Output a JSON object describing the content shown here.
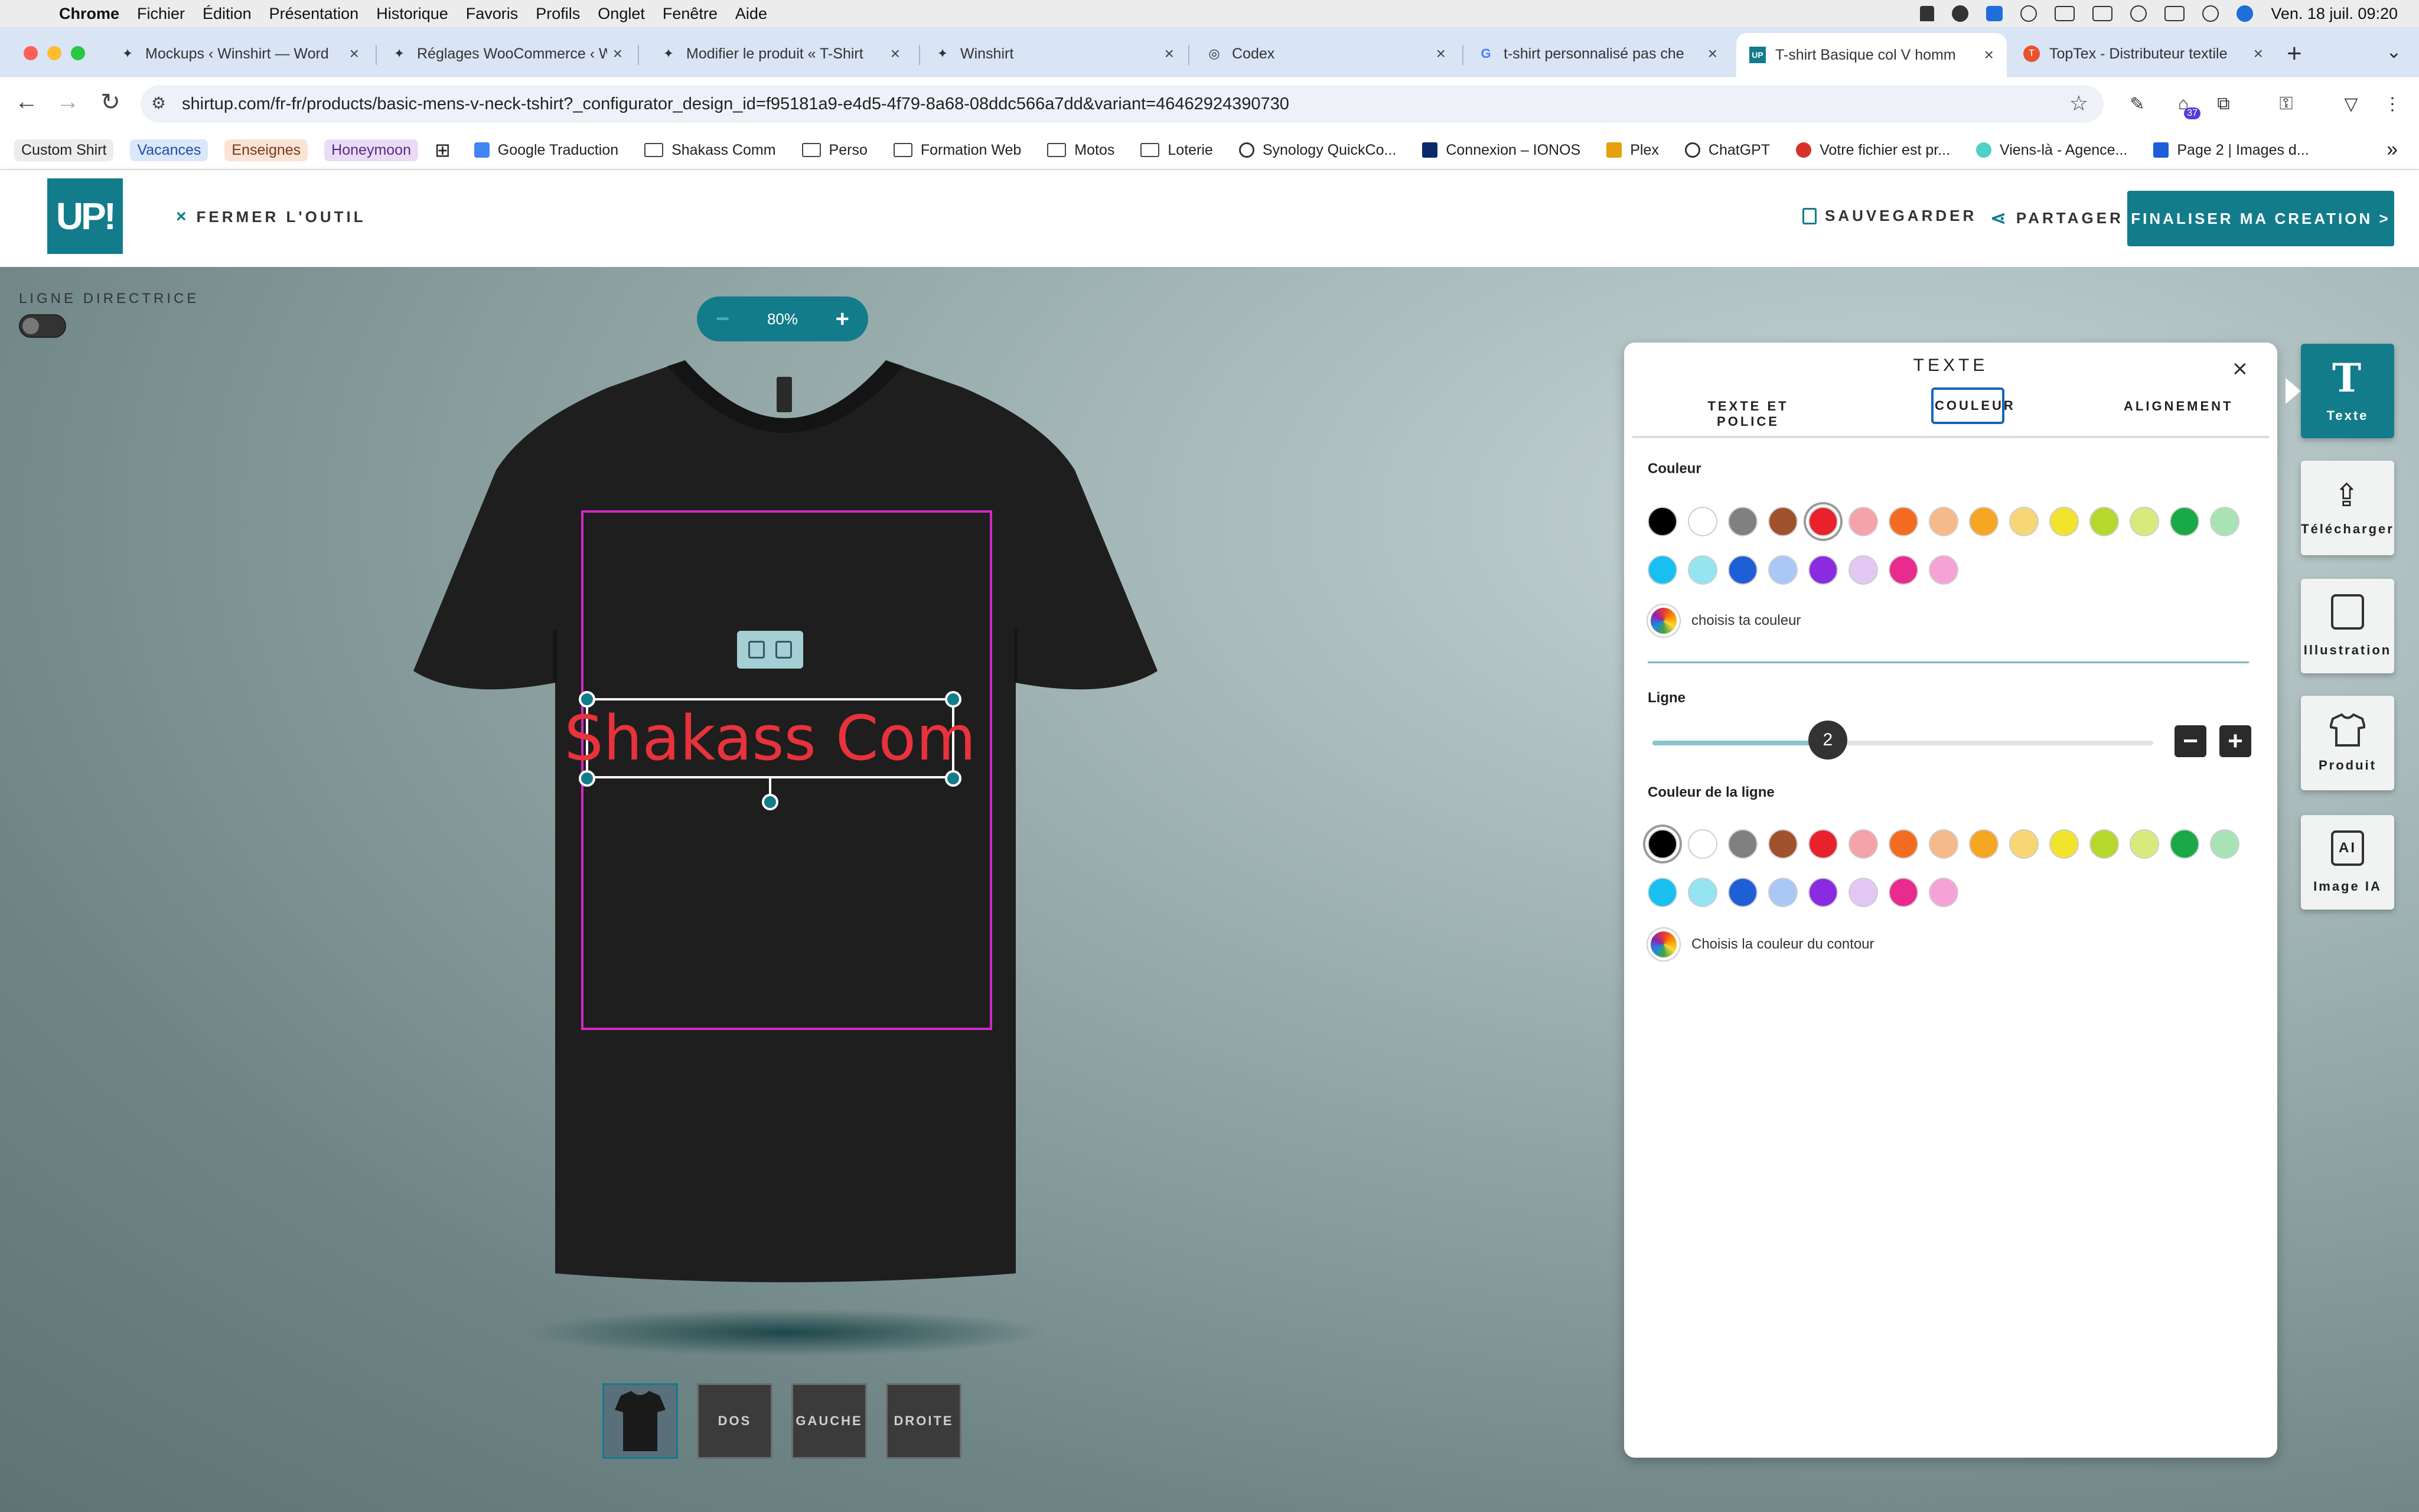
{
  "menubar": {
    "items": [
      "Chrome",
      "Fichier",
      "Édition",
      "Présentation",
      "Historique",
      "Favoris",
      "Profils",
      "Onglet",
      "Fenêtre",
      "Aide"
    ],
    "clock": "Ven. 18 juil.  09:20",
    "badge": "37"
  },
  "tabs": [
    {
      "label": "Mockups ‹ Winshirt — Word",
      "icon": "wordpress-icon"
    },
    {
      "label": "Réglages WooCommerce ‹ W",
      "icon": "wordpress-icon"
    },
    {
      "label": "Modifier le produit « T-Shirt",
      "icon": "wordpress-icon"
    },
    {
      "label": "Winshirt",
      "icon": "wordpress-icon"
    },
    {
      "label": "Codex",
      "icon": "codex-icon"
    },
    {
      "label": "t-shirt personnalisé pas che",
      "icon": "google-icon"
    },
    {
      "label": "T-shirt Basique col V homm",
      "icon": "shirtup-icon",
      "active": true
    },
    {
      "label": "TopTex - Distributeur textile",
      "icon": "toptex-icon"
    }
  ],
  "address": {
    "url": "shirtup.com/fr-fr/products/basic-mens-v-neck-tshirt?_configurator_design_id=f95181a9-e4d5-4f79-8a68-08ddc566a7dd&variant=46462924390730"
  },
  "bookmarks": [
    {
      "label": "Custom Shirt",
      "kind": "pill",
      "color": "#e7e7e7"
    },
    {
      "label": "Vacances",
      "kind": "pill",
      "color": "#dbe7fb"
    },
    {
      "label": "Enseignes",
      "kind": "pill",
      "color": "#fbe3d6"
    },
    {
      "label": "Honeymoon",
      "kind": "pill",
      "color": "#eadcf7"
    },
    {
      "label": "Google Traduction",
      "kind": "site"
    },
    {
      "label": "Shakass Comm",
      "kind": "folder"
    },
    {
      "label": "Perso",
      "kind": "folder"
    },
    {
      "label": "Formation Web",
      "kind": "folder"
    },
    {
      "label": "Motos",
      "kind": "folder"
    },
    {
      "label": "Loterie",
      "kind": "folder"
    },
    {
      "label": "Synology QuickCo...",
      "kind": "site"
    },
    {
      "label": "Connexion – IONOS",
      "kind": "site"
    },
    {
      "label": "Plex",
      "kind": "site"
    },
    {
      "label": "ChatGPT",
      "kind": "site"
    },
    {
      "label": "Votre fichier est pr...",
      "kind": "site"
    },
    {
      "label": "Viens-là - Agence...",
      "kind": "site"
    },
    {
      "label": "Page 2 | Images d...",
      "kind": "site"
    }
  ],
  "header": {
    "logo": "UP!",
    "close_tool": "FERMER L'OUTIL",
    "save": "SAUVEGARDER",
    "share": "PARTAGER",
    "finalize": "FINALISER MA CREATION >"
  },
  "canvas": {
    "guide_label": "LIGNE DIRECTRICE",
    "guide_on": false,
    "zoom": "80%",
    "design_text": "Shakass Com",
    "design_text_color": "#e8323c",
    "views": [
      "",
      "DOS",
      "GAUCHE",
      "DROITE"
    ]
  },
  "panel": {
    "title": "TEXTE",
    "tabs": [
      "TEXTE ET POLICE",
      "COULEUR",
      "ALIGNEMENT"
    ],
    "active_tab": "COULEUR",
    "color_label": "Couleur",
    "palette": [
      "#000000",
      "#ffffff",
      "#808080",
      "#a0522d",
      "#e8212b",
      "#f4a3a8",
      "#f26d21",
      "#f5b98a",
      "#f5a623",
      "#f7d774",
      "#f2e32c",
      "#b6d72c",
      "#d9ea7c",
      "#19a947",
      "#a8e3b5",
      "#17c0f0",
      "#94e4f2",
      "#1f5fd6",
      "#a9c8f5",
      "#8a2be2",
      "#e2c7f2",
      "#e92a8e",
      "#f5a3d6"
    ],
    "selected_fill": "#e8212b",
    "custom_color": "choisis ta couleur",
    "line_label": "Ligne",
    "line_value": "2",
    "line_fraction": 0.35,
    "line_color_label": "Couleur de la ligne",
    "selected_line": "#000000",
    "custom_line_color": "Choisis la couleur du contour"
  },
  "sidebar": [
    {
      "label": "Texte",
      "icon": "text-icon",
      "active": true
    },
    {
      "label": "Télécharger",
      "icon": "upload-icon"
    },
    {
      "label": "Illustration",
      "icon": "sticker-icon"
    },
    {
      "label": "Produit",
      "icon": "tshirt-icon"
    },
    {
      "label": "Image IA",
      "icon": "ai-image-icon"
    }
  ]
}
